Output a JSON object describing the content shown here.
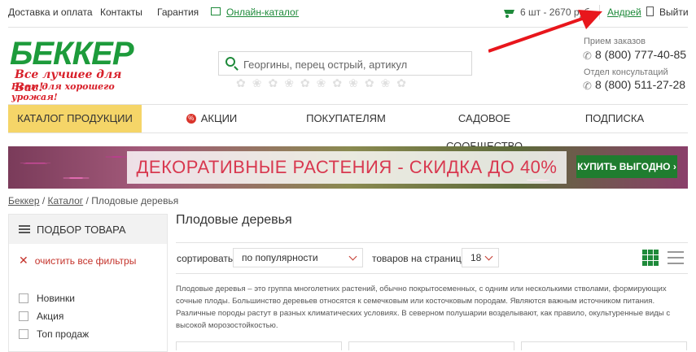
{
  "topbar": {
    "delivery": "Доставка и оплата",
    "contacts": "Контакты",
    "warranty": "Гарантия",
    "online_catalog": "Онлайн-каталог",
    "cart": "6 шт - 2670 руб",
    "user": "Андрей",
    "logout": "Выйти"
  },
  "logo": {
    "name": "БЕККЕР",
    "slogan": "Все лучшее для Вас!",
    "tagline": "Всем для хорошего урожая!"
  },
  "search": {
    "placeholder": "Георгины, перец острый, артикул"
  },
  "contacts": {
    "orders_label": "Прием заказов",
    "orders_phone": "8 (800) 777-40-85",
    "consult_label": "Отдел консультаций",
    "consult_phone": "8 (800) 511-27-28"
  },
  "nav": {
    "catalog": "КАТАЛОГ ПРОДУКЦИИ",
    "promo": "АКЦИИ",
    "buyers": "ПОКУПАТЕЛЯМ",
    "community": "САДОВОЕ СООБЩЕСТВО",
    "subscribe": "ПОДПИСКА",
    "promo_badge": "%"
  },
  "banner": {
    "text": "ДЕКОРАТИВНЫЕ РАСТЕНИЯ - СКИДКА ДО 40%",
    "button": "КУПИТЬ ВЫГОДНО"
  },
  "breadcrumb": {
    "home": "Беккер",
    "catalog": "Каталог",
    "current": "Плодовые деревья"
  },
  "sidebar": {
    "title": "ПОДБОР ТОВАРА",
    "clear": "очистить все фильтры",
    "filters": [
      "Новинки",
      "Акция",
      "Топ продаж"
    ]
  },
  "main": {
    "title": "Плодовые деревья",
    "sort_label": "сортировать",
    "sort_value": "по популярности",
    "per_page_label": "товаров на странице",
    "per_page_value": "18",
    "description": "Плодовые деревья – это группа многолетних растений, обычно покрытосеменных, с одним или несколькими стволами, формирующих сочные плоды. Большинство деревьев относятся к семечковым или косточковым породам. Являются важным источником питания. Различные породы растут в разных климатических условиях. В северном полушарии возделывают, как правило, окультуренные виды с высокой морозостойкостью."
  },
  "colors": {
    "brand_green": "#1d9b3b",
    "accent_red": "#d8202a",
    "nav_active": "#f5d568",
    "button_green": "#1f7d2f"
  }
}
